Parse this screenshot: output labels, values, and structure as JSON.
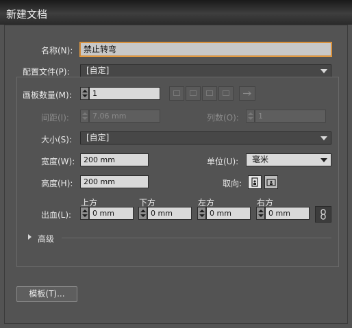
{
  "window": {
    "title": "新建文档"
  },
  "name": {
    "label": "名称(N):",
    "value": "禁止转弯"
  },
  "profile": {
    "label": "配置文件(P):",
    "value": "[自定]"
  },
  "artboards": {
    "count_label": "画板数量(M):",
    "count_value": "1",
    "spacing_label": "间距(I):",
    "spacing_value": "7.06 mm",
    "columns_label": "列数(O):",
    "columns_value": "1"
  },
  "size": {
    "label": "大小(S):",
    "value": "[自定]"
  },
  "width": {
    "label": "宽度(W):",
    "value": "200 mm"
  },
  "height": {
    "label": "高度(H):",
    "value": "200 mm"
  },
  "units": {
    "label": "单位(U):",
    "value": "毫米"
  },
  "orientation": {
    "label": "取向:"
  },
  "bleed": {
    "label": "出血(L):",
    "top": {
      "label": "上方",
      "value": "0 mm"
    },
    "bottom": {
      "label": "下方",
      "value": "0 mm"
    },
    "left": {
      "label": "左方",
      "value": "0 mm"
    },
    "right": {
      "label": "右方",
      "value": "0 mm"
    }
  },
  "advanced": {
    "label": "高级"
  },
  "templates_button": "模板(T)..."
}
